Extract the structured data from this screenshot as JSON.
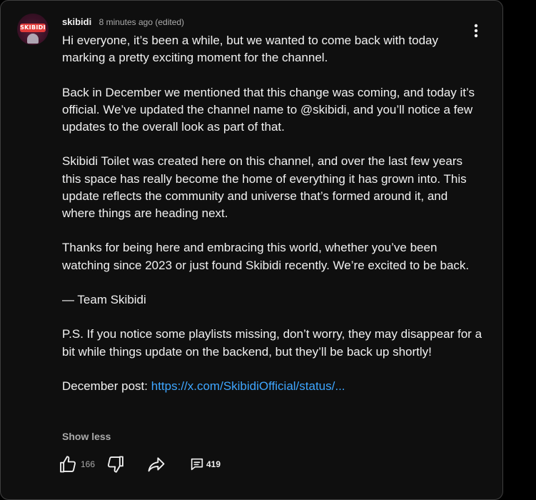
{
  "post": {
    "author": "skibidi",
    "time": "8 minutes ago (edited)",
    "avatar_text": "SKIBIDI",
    "paragraphs": [
      "Hi everyone, it’s been a while, but we wanted to come back with today marking a pretty exciting moment for the channel.",
      "Back in December we mentioned that this change was coming, and today it’s official. We’ve updated the channel name to @skibidi, and you’ll notice a few updates to the overall look as part of that.",
      "Skibidi Toilet was created here on this channel, and over the last few years this space has really become the home of everything it has grown into. This update reflects the community and universe that’s formed around it, and where things are heading next.",
      "Thanks for being here and embracing this world, whether you’ve been watching since 2023 or just found Skibidi recently. We’re excited to be back.",
      "— Team Skibidi",
      "P.S. If you notice some playlists missing, don’t worry, they may disappear for a bit while things update on the backend, but they’ll be back up shortly!"
    ],
    "link_prefix": "December post: ",
    "link_text": "https://x.com/SkibidiOfficial/status/...",
    "show_less": "Show less"
  },
  "actions": {
    "like_count": "166",
    "reply_count": "419"
  },
  "colors": {
    "background": "#0f0f0f",
    "text": "#f1f1f1",
    "muted": "#aaaaaa",
    "link": "#3ea6ff",
    "border": "#3f3f3f"
  },
  "icons": [
    "three-dots-vertical-icon",
    "thumbs-up-icon",
    "thumbs-down-icon",
    "share-icon",
    "comment-icon"
  ]
}
